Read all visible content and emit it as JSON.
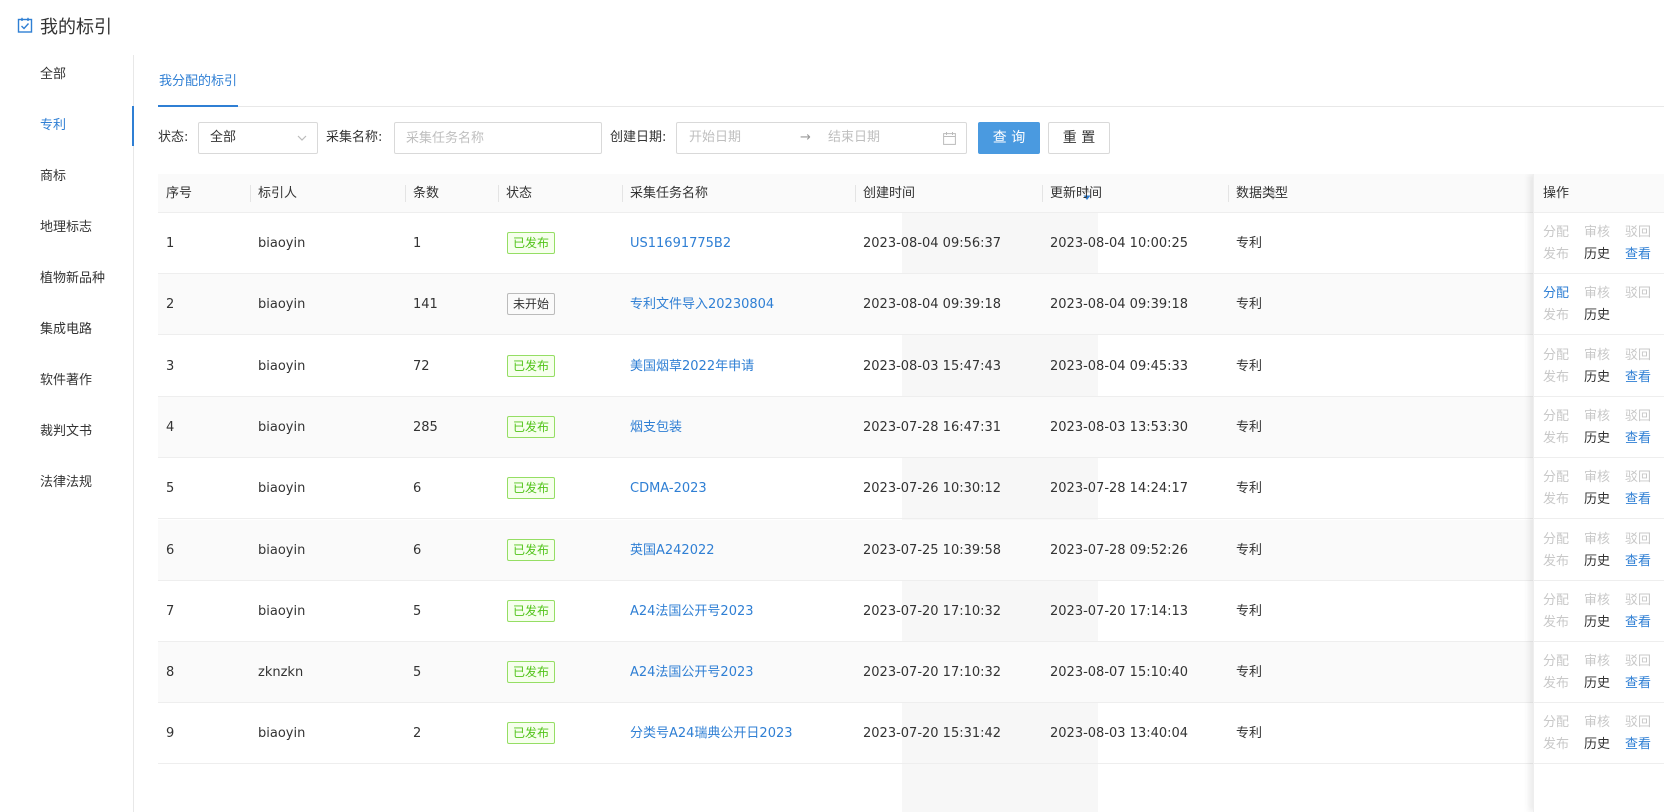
{
  "header": {
    "title": "我的标引"
  },
  "sidebar": {
    "items": [
      {
        "label": "全部"
      },
      {
        "label": "专利"
      },
      {
        "label": "商标"
      },
      {
        "label": "地理标志"
      },
      {
        "label": "植物新品种"
      },
      {
        "label": "集成电路"
      },
      {
        "label": "软件著作"
      },
      {
        "label": "裁判文书"
      },
      {
        "label": "法律法规"
      }
    ],
    "active_index": 1
  },
  "tabs": [
    {
      "label": "我分配的标引"
    }
  ],
  "filters": {
    "status_label": "状态:",
    "status_value": "全部",
    "task_name_label": "采集名称:",
    "task_name_placeholder": "采集任务名称",
    "date_label": "创建日期:",
    "start_placeholder": "开始日期",
    "range_arrow": "→",
    "end_placeholder": "结束日期",
    "query_button": "查 询",
    "reset_button": "重 置"
  },
  "table": {
    "columns": [
      "序号",
      "标引人",
      "条数",
      "状态",
      "采集任务名称",
      "创建时间",
      "更新时间",
      "数据类型",
      "操作"
    ],
    "ops": {
      "assign": "分配",
      "review": "审核",
      "reject": "驳回",
      "publish": "发布",
      "history": "历史",
      "view": "查看"
    },
    "rows": [
      {
        "no": "1",
        "user": "biaoyin",
        "count": "1",
        "status": "已发布",
        "task": "US11691775B2",
        "created": "2023-08-04 09:56:37",
        "updated": "2023-08-04 10:00:25",
        "type": "专利",
        "assign_enabled": false,
        "show_view": true
      },
      {
        "no": "2",
        "user": "biaoyin",
        "count": "141",
        "status": "未开始",
        "task": "专利文件导入20230804",
        "created": "2023-08-04 09:39:18",
        "updated": "2023-08-04 09:39:18",
        "type": "专利",
        "assign_enabled": true,
        "show_view": false
      },
      {
        "no": "3",
        "user": "biaoyin",
        "count": "72",
        "status": "已发布",
        "task": "美国烟草2022年申请",
        "created": "2023-08-03 15:47:43",
        "updated": "2023-08-04 09:45:33",
        "type": "专利",
        "assign_enabled": false,
        "show_view": true
      },
      {
        "no": "4",
        "user": "biaoyin",
        "count": "285",
        "status": "已发布",
        "task": "烟支包装",
        "created": "2023-07-28 16:47:31",
        "updated": "2023-08-03 13:53:30",
        "type": "专利",
        "assign_enabled": false,
        "show_view": true
      },
      {
        "no": "5",
        "user": "biaoyin",
        "count": "6",
        "status": "已发布",
        "task": "CDMA-2023",
        "created": "2023-07-26 10:30:12",
        "updated": "2023-07-28 14:24:17",
        "type": "专利",
        "assign_enabled": false,
        "show_view": true
      },
      {
        "no": "6",
        "user": "biaoyin",
        "count": "6",
        "status": "已发布",
        "task": "英国A242022",
        "created": "2023-07-25 10:39:58",
        "updated": "2023-07-28 09:52:26",
        "type": "专利",
        "assign_enabled": false,
        "show_view": true
      },
      {
        "no": "7",
        "user": "biaoyin",
        "count": "5",
        "status": "已发布",
        "task": "A24法国公开号2023",
        "created": "2023-07-20 17:10:32",
        "updated": "2023-07-20 17:14:13",
        "type": "专利",
        "assign_enabled": false,
        "show_view": true
      },
      {
        "no": "8",
        "user": "zknzkn",
        "count": "5",
        "status": "已发布",
        "task": "A24法国公开号2023",
        "created": "2023-07-20 17:10:32",
        "updated": "2023-08-07 15:10:40",
        "type": "专利",
        "assign_enabled": false,
        "show_view": true
      },
      {
        "no": "9",
        "user": "biaoyin",
        "count": "2",
        "status": "已发布",
        "task": "分类号A24瑞典公开日2023",
        "created": "2023-07-20 15:31:42",
        "updated": "2023-08-03 13:40:04",
        "type": "专利",
        "assign_enabled": false,
        "show_view": true
      }
    ]
  },
  "colors": {
    "accent": "#2f7fd4",
    "primary_button": "#4a9ae0",
    "tag_green": "#52c41a"
  }
}
